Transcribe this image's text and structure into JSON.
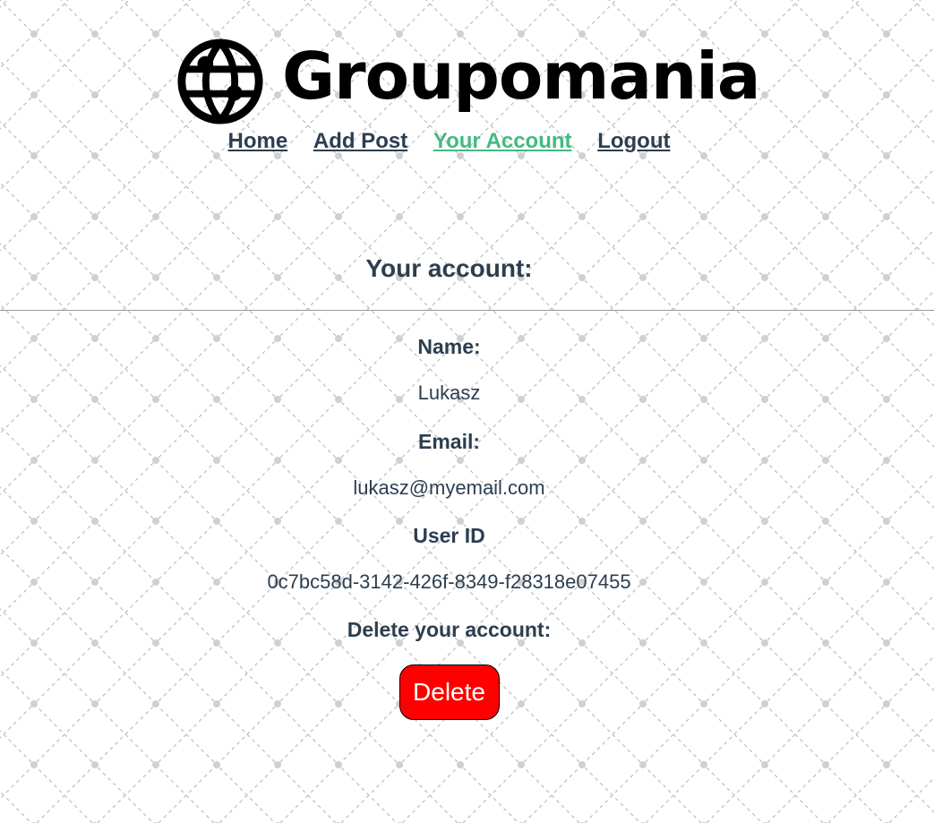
{
  "header": {
    "logo_text": "Groupomania",
    "logo_icon": "globe-icon"
  },
  "nav": {
    "items": [
      {
        "label": "Home",
        "active": false
      },
      {
        "label": "Add Post",
        "active": false
      },
      {
        "label": "Your Account",
        "active": true
      },
      {
        "label": "Logout",
        "active": false
      }
    ],
    "active_color": "#42b983",
    "text_color": "#2c3e50"
  },
  "account": {
    "title": "Your account:",
    "name_label": "Name:",
    "name_value": "Lukasz",
    "email_label": "Email:",
    "email_value": "lukasz@myemail.com",
    "user_id_label": "User ID",
    "user_id_value": "0c7bc58d-3142-426f-8349-f28318e07455",
    "delete_label": "Delete your account:",
    "delete_button": "Delete",
    "delete_color": "#ff0000"
  }
}
